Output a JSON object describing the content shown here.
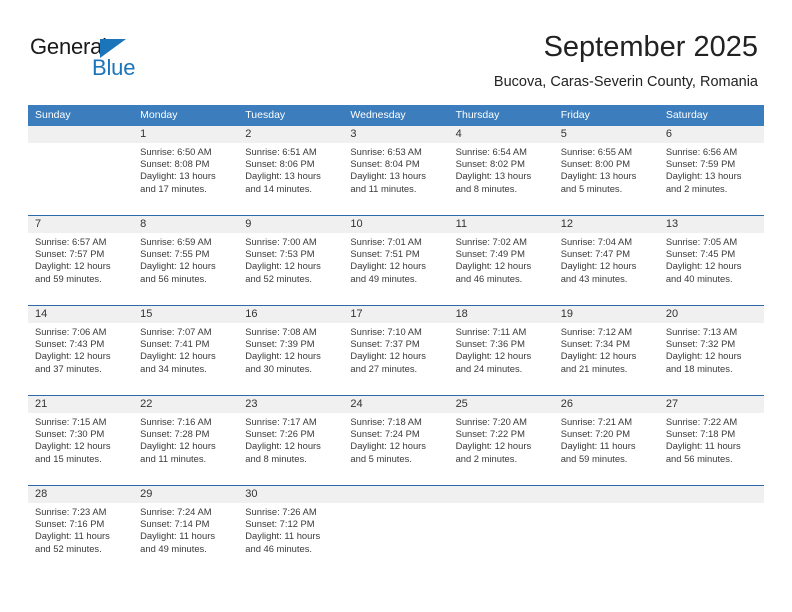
{
  "brand": {
    "name_part1": "General",
    "name_part2": "Blue",
    "accent_color": "#1b75bb"
  },
  "header": {
    "title": "September 2025",
    "subtitle": "Bucova, Caras-Severin County, Romania"
  },
  "calendar": {
    "header_bg": "#3b7dbd",
    "weekdays": [
      "Sunday",
      "Monday",
      "Tuesday",
      "Wednesday",
      "Thursday",
      "Friday",
      "Saturday"
    ],
    "weeks": [
      [
        {
          "day": "",
          "sunrise": "",
          "sunset": "",
          "daylight_line1": "",
          "daylight_line2": ""
        },
        {
          "day": "1",
          "sunrise": "Sunrise: 6:50 AM",
          "sunset": "Sunset: 8:08 PM",
          "daylight_line1": "Daylight: 13 hours",
          "daylight_line2": "and 17 minutes."
        },
        {
          "day": "2",
          "sunrise": "Sunrise: 6:51 AM",
          "sunset": "Sunset: 8:06 PM",
          "daylight_line1": "Daylight: 13 hours",
          "daylight_line2": "and 14 minutes."
        },
        {
          "day": "3",
          "sunrise": "Sunrise: 6:53 AM",
          "sunset": "Sunset: 8:04 PM",
          "daylight_line1": "Daylight: 13 hours",
          "daylight_line2": "and 11 minutes."
        },
        {
          "day": "4",
          "sunrise": "Sunrise: 6:54 AM",
          "sunset": "Sunset: 8:02 PM",
          "daylight_line1": "Daylight: 13 hours",
          "daylight_line2": "and 8 minutes."
        },
        {
          "day": "5",
          "sunrise": "Sunrise: 6:55 AM",
          "sunset": "Sunset: 8:00 PM",
          "daylight_line1": "Daylight: 13 hours",
          "daylight_line2": "and 5 minutes."
        },
        {
          "day": "6",
          "sunrise": "Sunrise: 6:56 AM",
          "sunset": "Sunset: 7:59 PM",
          "daylight_line1": "Daylight: 13 hours",
          "daylight_line2": "and 2 minutes."
        }
      ],
      [
        {
          "day": "7",
          "sunrise": "Sunrise: 6:57 AM",
          "sunset": "Sunset: 7:57 PM",
          "daylight_line1": "Daylight: 12 hours",
          "daylight_line2": "and 59 minutes."
        },
        {
          "day": "8",
          "sunrise": "Sunrise: 6:59 AM",
          "sunset": "Sunset: 7:55 PM",
          "daylight_line1": "Daylight: 12 hours",
          "daylight_line2": "and 56 minutes."
        },
        {
          "day": "9",
          "sunrise": "Sunrise: 7:00 AM",
          "sunset": "Sunset: 7:53 PM",
          "daylight_line1": "Daylight: 12 hours",
          "daylight_line2": "and 52 minutes."
        },
        {
          "day": "10",
          "sunrise": "Sunrise: 7:01 AM",
          "sunset": "Sunset: 7:51 PM",
          "daylight_line1": "Daylight: 12 hours",
          "daylight_line2": "and 49 minutes."
        },
        {
          "day": "11",
          "sunrise": "Sunrise: 7:02 AM",
          "sunset": "Sunset: 7:49 PM",
          "daylight_line1": "Daylight: 12 hours",
          "daylight_line2": "and 46 minutes."
        },
        {
          "day": "12",
          "sunrise": "Sunrise: 7:04 AM",
          "sunset": "Sunset: 7:47 PM",
          "daylight_line1": "Daylight: 12 hours",
          "daylight_line2": "and 43 minutes."
        },
        {
          "day": "13",
          "sunrise": "Sunrise: 7:05 AM",
          "sunset": "Sunset: 7:45 PM",
          "daylight_line1": "Daylight: 12 hours",
          "daylight_line2": "and 40 minutes."
        }
      ],
      [
        {
          "day": "14",
          "sunrise": "Sunrise: 7:06 AM",
          "sunset": "Sunset: 7:43 PM",
          "daylight_line1": "Daylight: 12 hours",
          "daylight_line2": "and 37 minutes."
        },
        {
          "day": "15",
          "sunrise": "Sunrise: 7:07 AM",
          "sunset": "Sunset: 7:41 PM",
          "daylight_line1": "Daylight: 12 hours",
          "daylight_line2": "and 34 minutes."
        },
        {
          "day": "16",
          "sunrise": "Sunrise: 7:08 AM",
          "sunset": "Sunset: 7:39 PM",
          "daylight_line1": "Daylight: 12 hours",
          "daylight_line2": "and 30 minutes."
        },
        {
          "day": "17",
          "sunrise": "Sunrise: 7:10 AM",
          "sunset": "Sunset: 7:37 PM",
          "daylight_line1": "Daylight: 12 hours",
          "daylight_line2": "and 27 minutes."
        },
        {
          "day": "18",
          "sunrise": "Sunrise: 7:11 AM",
          "sunset": "Sunset: 7:36 PM",
          "daylight_line1": "Daylight: 12 hours",
          "daylight_line2": "and 24 minutes."
        },
        {
          "day": "19",
          "sunrise": "Sunrise: 7:12 AM",
          "sunset": "Sunset: 7:34 PM",
          "daylight_line1": "Daylight: 12 hours",
          "daylight_line2": "and 21 minutes."
        },
        {
          "day": "20",
          "sunrise": "Sunrise: 7:13 AM",
          "sunset": "Sunset: 7:32 PM",
          "daylight_line1": "Daylight: 12 hours",
          "daylight_line2": "and 18 minutes."
        }
      ],
      [
        {
          "day": "21",
          "sunrise": "Sunrise: 7:15 AM",
          "sunset": "Sunset: 7:30 PM",
          "daylight_line1": "Daylight: 12 hours",
          "daylight_line2": "and 15 minutes."
        },
        {
          "day": "22",
          "sunrise": "Sunrise: 7:16 AM",
          "sunset": "Sunset: 7:28 PM",
          "daylight_line1": "Daylight: 12 hours",
          "daylight_line2": "and 11 minutes."
        },
        {
          "day": "23",
          "sunrise": "Sunrise: 7:17 AM",
          "sunset": "Sunset: 7:26 PM",
          "daylight_line1": "Daylight: 12 hours",
          "daylight_line2": "and 8 minutes."
        },
        {
          "day": "24",
          "sunrise": "Sunrise: 7:18 AM",
          "sunset": "Sunset: 7:24 PM",
          "daylight_line1": "Daylight: 12 hours",
          "daylight_line2": "and 5 minutes."
        },
        {
          "day": "25",
          "sunrise": "Sunrise: 7:20 AM",
          "sunset": "Sunset: 7:22 PM",
          "daylight_line1": "Daylight: 12 hours",
          "daylight_line2": "and 2 minutes."
        },
        {
          "day": "26",
          "sunrise": "Sunrise: 7:21 AM",
          "sunset": "Sunset: 7:20 PM",
          "daylight_line1": "Daylight: 11 hours",
          "daylight_line2": "and 59 minutes."
        },
        {
          "day": "27",
          "sunrise": "Sunrise: 7:22 AM",
          "sunset": "Sunset: 7:18 PM",
          "daylight_line1": "Daylight: 11 hours",
          "daylight_line2": "and 56 minutes."
        }
      ],
      [
        {
          "day": "28",
          "sunrise": "Sunrise: 7:23 AM",
          "sunset": "Sunset: 7:16 PM",
          "daylight_line1": "Daylight: 11 hours",
          "daylight_line2": "and 52 minutes."
        },
        {
          "day": "29",
          "sunrise": "Sunrise: 7:24 AM",
          "sunset": "Sunset: 7:14 PM",
          "daylight_line1": "Daylight: 11 hours",
          "daylight_line2": "and 49 minutes."
        },
        {
          "day": "30",
          "sunrise": "Sunrise: 7:26 AM",
          "sunset": "Sunset: 7:12 PM",
          "daylight_line1": "Daylight: 11 hours",
          "daylight_line2": "and 46 minutes."
        },
        {
          "day": "",
          "sunrise": "",
          "sunset": "",
          "daylight_line1": "",
          "daylight_line2": ""
        },
        {
          "day": "",
          "sunrise": "",
          "sunset": "",
          "daylight_line1": "",
          "daylight_line2": ""
        },
        {
          "day": "",
          "sunrise": "",
          "sunset": "",
          "daylight_line1": "",
          "daylight_line2": ""
        },
        {
          "day": "",
          "sunrise": "",
          "sunset": "",
          "daylight_line1": "",
          "daylight_line2": ""
        }
      ]
    ]
  }
}
